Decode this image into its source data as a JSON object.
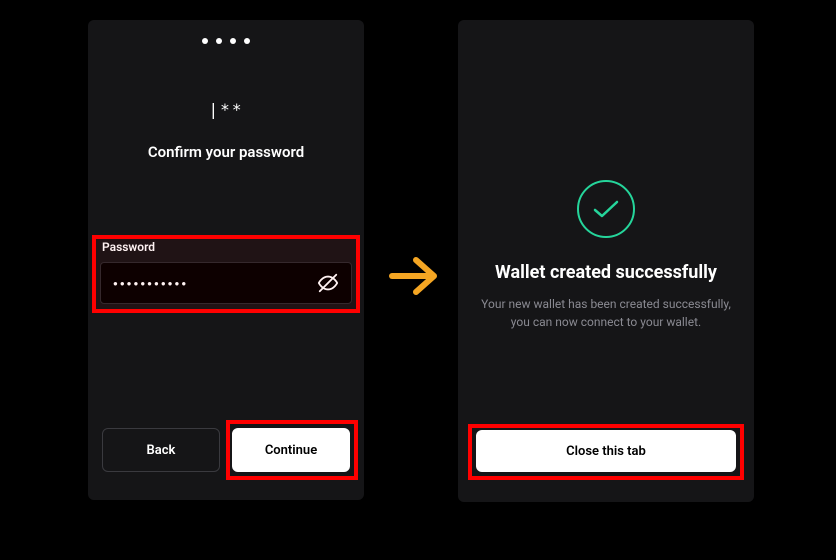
{
  "left_screen": {
    "masked_preview": "|**",
    "title": "Confirm your password",
    "password_label": "Password",
    "password_value": "●●●●●●●●●●●",
    "back_label": "Back",
    "continue_label": "Continue"
  },
  "right_screen": {
    "title": "Wallet created successfully",
    "subtitle": "Your new wallet has been created successfully, you can now connect to your wallet.",
    "close_label": "Close this tab"
  },
  "colors": {
    "highlight": "#ff0000",
    "accent": "#25d59b",
    "arrow": "#f5a623"
  }
}
